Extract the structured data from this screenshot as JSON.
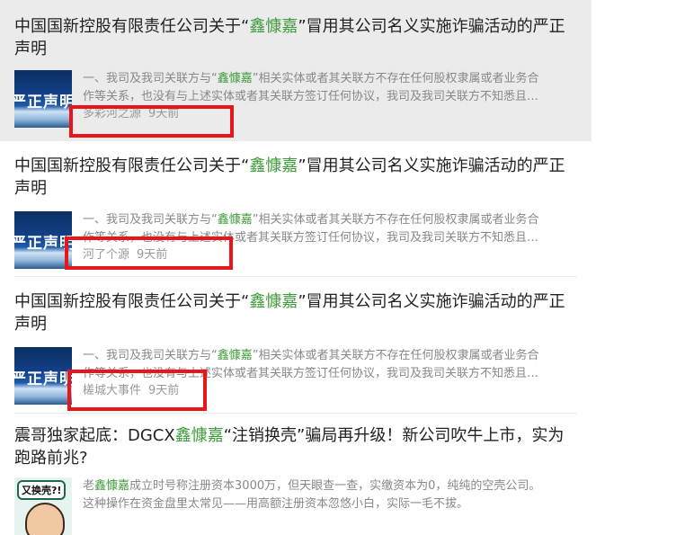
{
  "feed": {
    "items": [
      {
        "title_pre": "中国国新控股有限责任公司关于“",
        "title_kw": "鑫慷嘉",
        "title_post": "”冒用其公司名义实施诈骗活动的严正声明",
        "summary_l1_pre": "一、我司及我司关联方与“",
        "summary_l1_kw": "鑫慷嘉",
        "summary_l1_post": "”相关实体或者其关联方不存在任何股权隶属或者业务合",
        "summary_l2": "作等关系，也没有与上述实体或者其关联方签订任何协议，我司及我司关联方不知悉且…",
        "thumb_text": "严正声明",
        "source": "多彩河之源",
        "time": "9天前"
      },
      {
        "title_pre": "中国国新控股有限责任公司关于“",
        "title_kw": "鑫慷嘉",
        "title_post": "”冒用其公司名义实施诈骗活动的严正声明",
        "summary_l1_pre": "一、我司及我司关联方与“",
        "summary_l1_kw": "鑫慷嘉",
        "summary_l1_post": "”相关实体或者其关联方不存在任何股权隶属或者业务合",
        "summary_l2": "作等关系，也没有与上述实体或者其关联方签订任何协议，我司及我司关联方不知悉且…",
        "thumb_text": "严正声明",
        "source": "河了个源",
        "time": "9天前"
      },
      {
        "title_pre": "中国国新控股有限责任公司关于“",
        "title_kw": "鑫慷嘉",
        "title_post": "”冒用其公司名义实施诈骗活动的严正声明",
        "summary_l1_pre": "一、我司及我司关联方与“",
        "summary_l1_kw": "鑫慷嘉",
        "summary_l1_post": "”相关实体或者其关联方不存在任何股权隶属或者业务合",
        "summary_l2": "作等关系，也没有与上述实体或者其关联方签订任何协议，我司及我司关联方不知悉且…",
        "thumb_text": "严正声明",
        "source": "槎城大事件",
        "time": "9天前"
      },
      {
        "title_pre": "震哥独家起底：DGCX",
        "title_kw": "鑫慷嘉",
        "title_post": "“注销换壳”骗局再升级！新公司吹牛上市，实为跑路前兆?",
        "summary_l1_pre": "老",
        "summary_l1_kw": "鑫慷嘉",
        "summary_l1_post": "成立时号称注册资本3000万，但天眼查一查，实缴资本为0，纯纯的空壳公司。",
        "summary_l2": "这种操作在资金盘里太常见——用高额注册资本忽悠小白，实际一毛不拔。",
        "thumb_text": "又换壳?!"
      }
    ]
  },
  "colors": {
    "keyword": "#3e9b3a",
    "highlight_bg": "#ebebeb",
    "annotation_box": "#e8151b"
  }
}
